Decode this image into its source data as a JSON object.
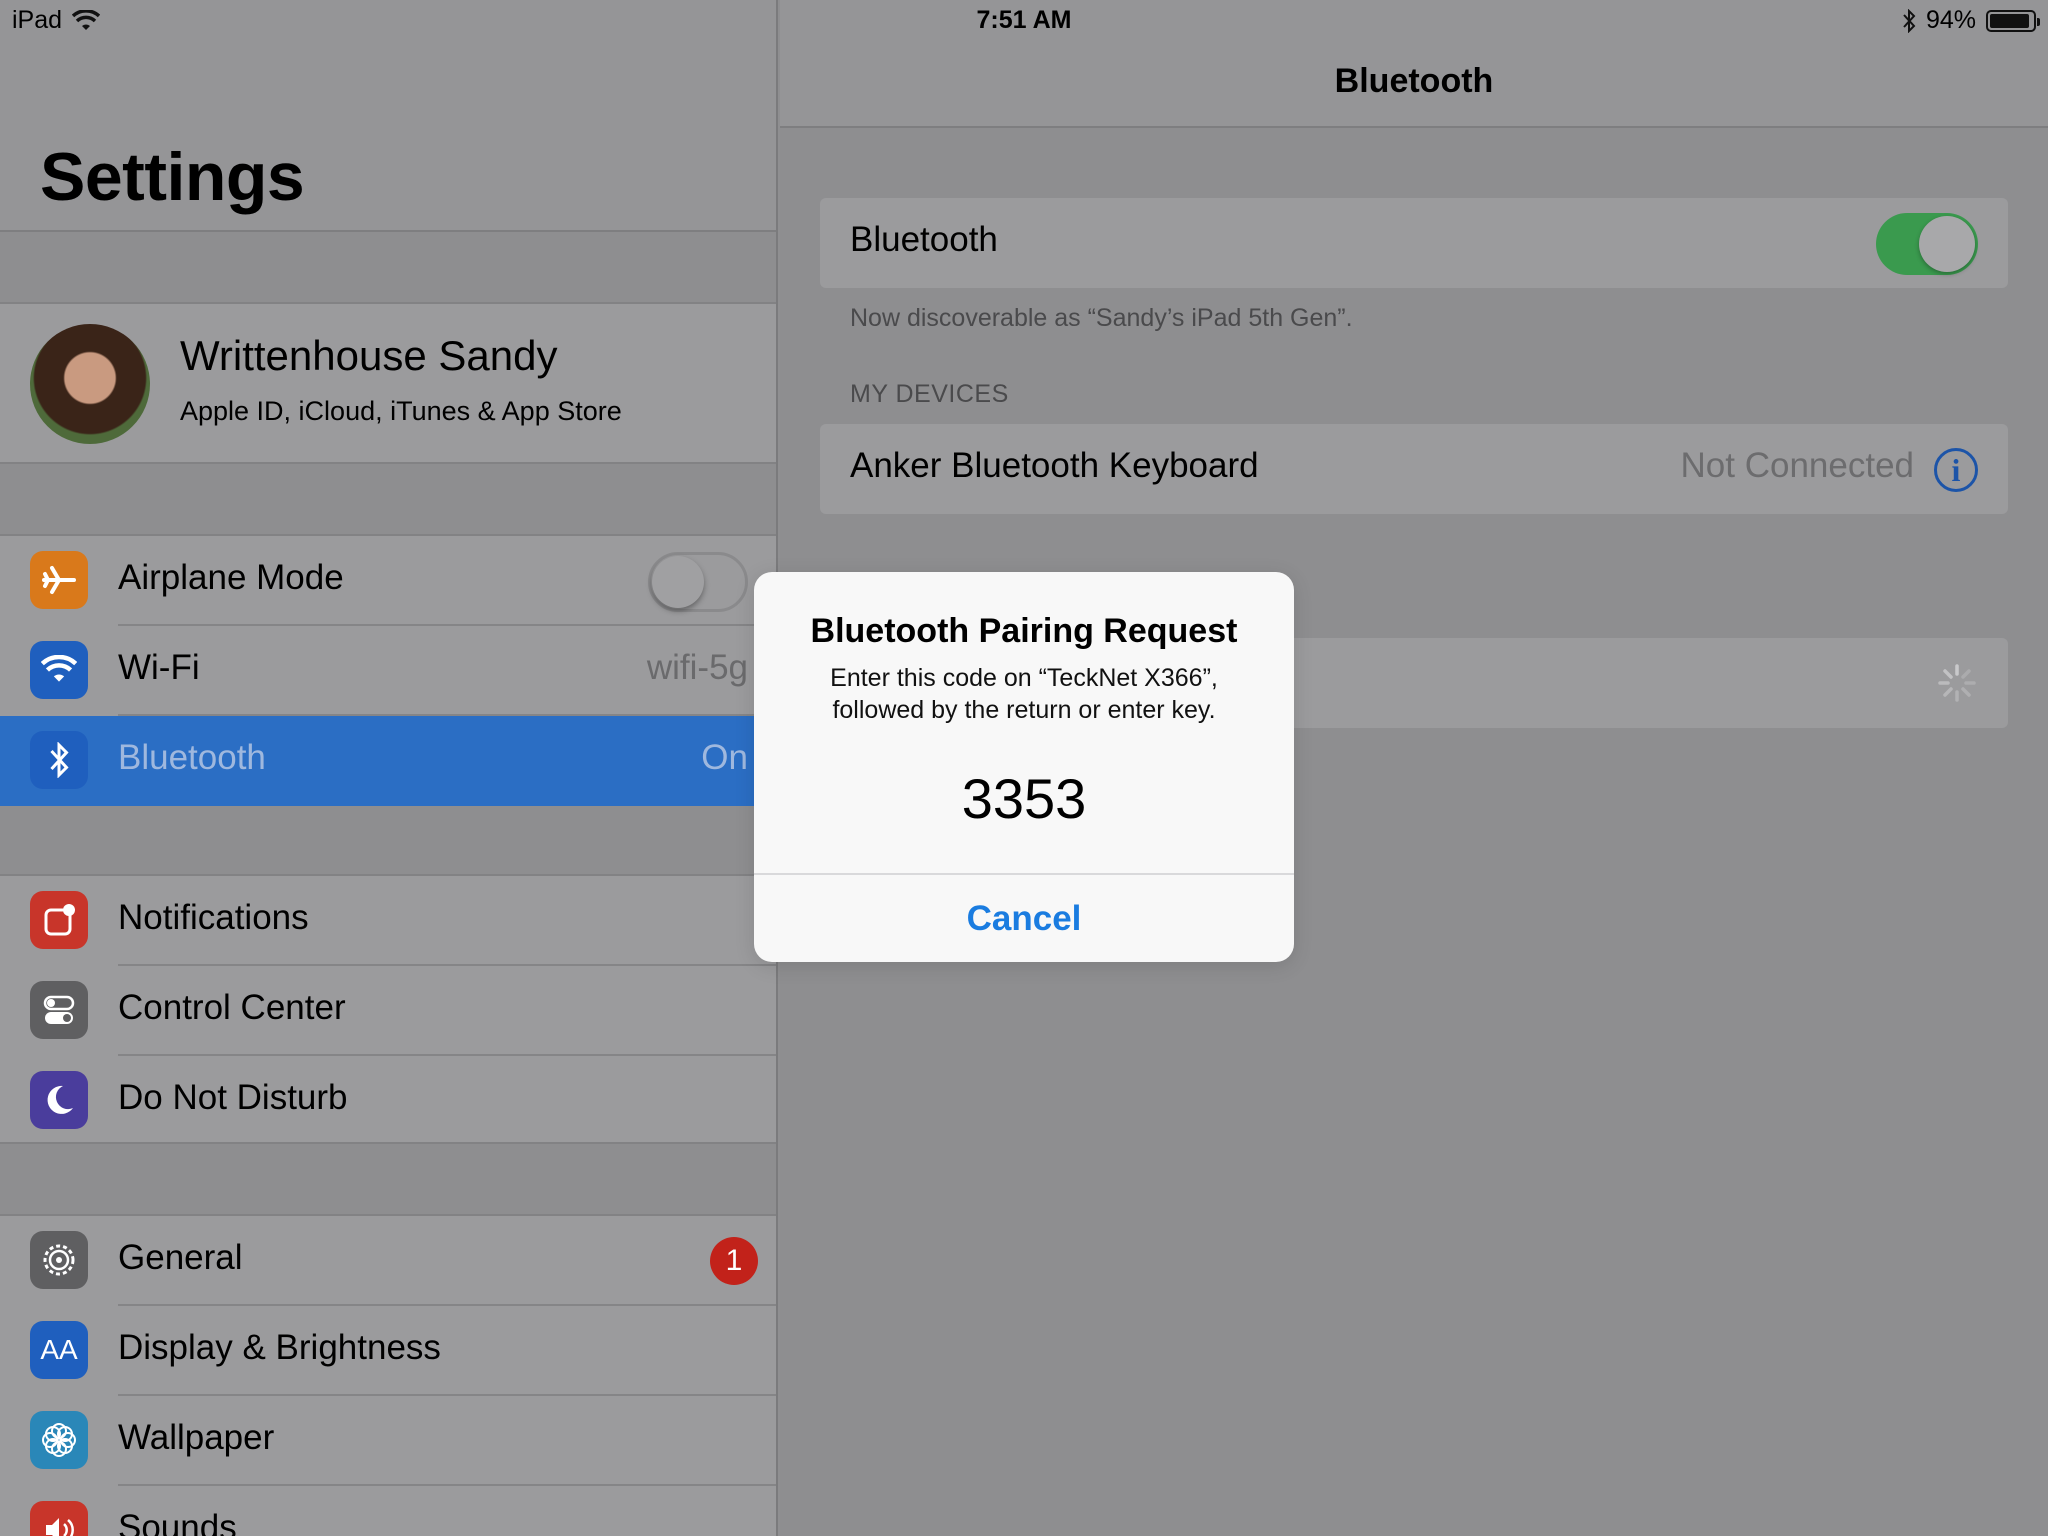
{
  "status_bar": {
    "device": "iPad",
    "time": "7:51 AM",
    "battery": "94%",
    "battery_level": 0.94
  },
  "master": {
    "title": "Settings",
    "profile": {
      "name": "Writtenhouse Sandy",
      "subtitle": "Apple ID, iCloud, iTunes & App Store"
    },
    "group1": [
      {
        "label": "Airplane Mode",
        "icon": "airplane-icon",
        "color": "#d9791b",
        "toggle": false
      },
      {
        "label": "Wi-Fi",
        "value": "wifi-5g",
        "icon": "wifi-icon",
        "color": "#1f5fbe"
      },
      {
        "label": "Bluetooth",
        "value": "On",
        "icon": "bluetooth-icon",
        "color": "#1f5fbe",
        "selected": true
      }
    ],
    "group2": [
      {
        "label": "Notifications",
        "icon": "notifications-icon",
        "color": "#c8352a"
      },
      {
        "label": "Control Center",
        "icon": "control-center-icon",
        "color": "#5f5f61"
      },
      {
        "label": "Do Not Disturb",
        "icon": "moon-icon",
        "color": "#4a3d9c"
      }
    ],
    "group3": [
      {
        "label": "General",
        "icon": "gear-icon",
        "color": "#5f5f61",
        "badge": "1"
      },
      {
        "label": "Display & Brightness",
        "icon": "display-icon",
        "color": "#1f5fbe",
        "icon_text": "AA"
      },
      {
        "label": "Wallpaper",
        "icon": "wallpaper-icon",
        "color": "#2a87b8"
      },
      {
        "label": "Sounds",
        "icon": "speaker-icon",
        "color": "#c8352a"
      }
    ]
  },
  "detail": {
    "nav_title": "Bluetooth",
    "bluetooth_label": "Bluetooth",
    "bluetooth_on": true,
    "discoverable_text": "Now discoverable as “Sandy’s iPad 5th Gen”.",
    "my_devices_header": "MY DEVICES",
    "devices": [
      {
        "name": "Anker Bluetooth Keyboard",
        "status": "Not Connected"
      }
    ]
  },
  "alert": {
    "title": "Bluetooth Pairing Request",
    "message_line1": "Enter this code on “TeckNet X366”,",
    "message_line2": "followed by the return or enter key.",
    "code": "3353",
    "cancel_label": "Cancel"
  },
  "colors": {
    "accent_blue": "#1a7ce0",
    "selection_blue": "#2b6ec4",
    "switch_green": "#3a9a4e",
    "badge_red": "#c2221a"
  }
}
